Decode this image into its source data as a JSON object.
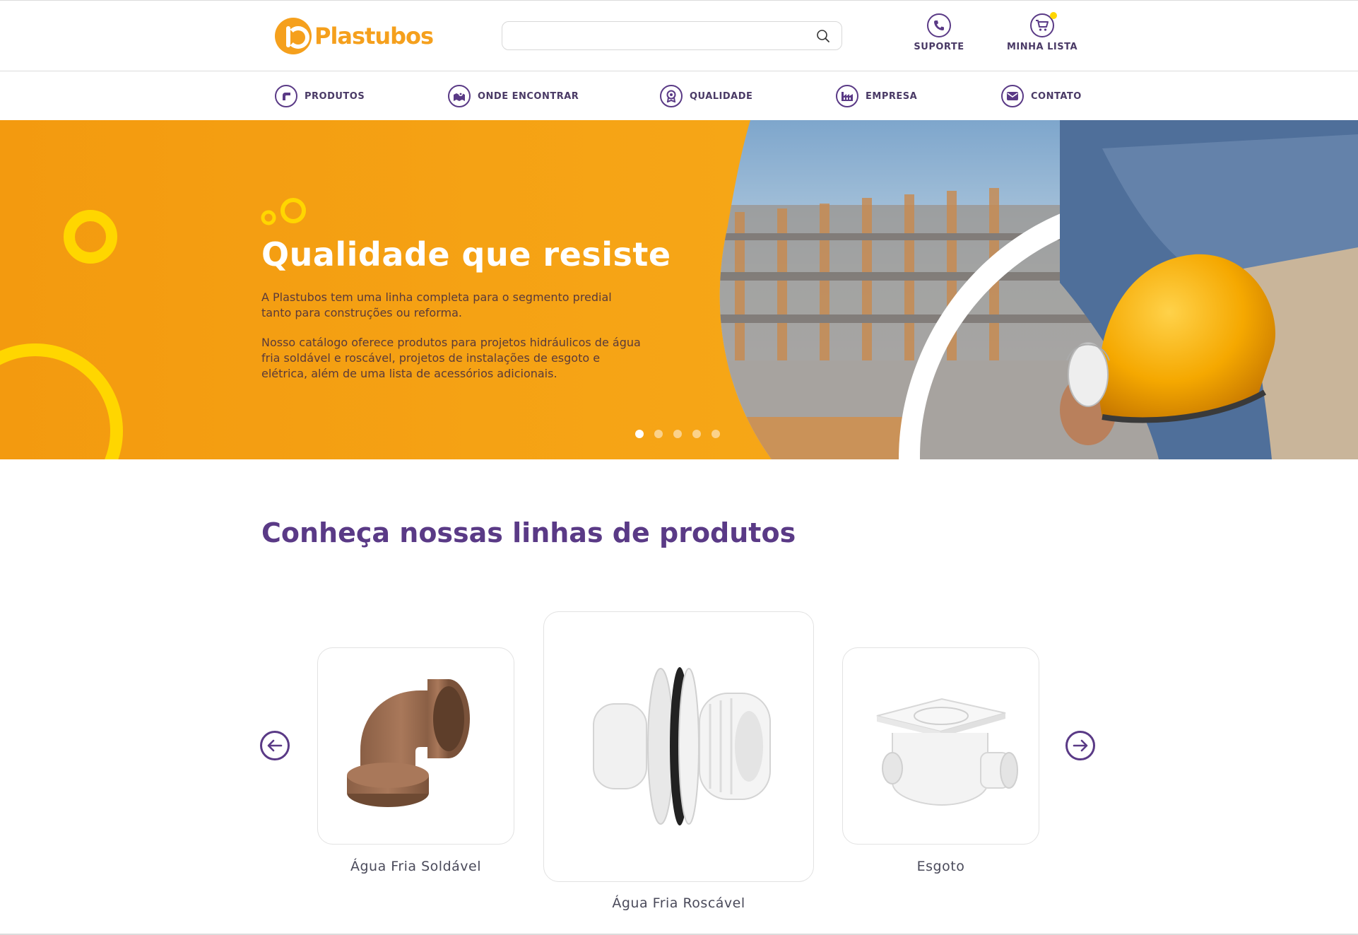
{
  "brand": {
    "name": "Plastubos",
    "orange": "#f5a01d",
    "purple": "#5a3a86",
    "yellow": "#ffd600"
  },
  "search": {
    "value": "",
    "placeholder": "",
    "icon": "search-icon"
  },
  "header_actions": [
    {
      "label": "SUPORTE",
      "icon": "phone-icon"
    },
    {
      "label": "MINHA LISTA",
      "icon": "cart-icon"
    }
  ],
  "nav": [
    {
      "label": "PRODUTOS",
      "icon": "pipe-icon"
    },
    {
      "label": "ONDE ENCONTRAR",
      "icon": "map-icon"
    },
    {
      "label": "QUALIDADE",
      "icon": "award-icon"
    },
    {
      "label": "EMPRESA",
      "icon": "factory-icon"
    },
    {
      "label": "CONTATO",
      "icon": "mail-icon"
    }
  ],
  "hero": {
    "title": "Qualidade que resiste",
    "paragraph_1": "A Plastubos tem uma linha completa para o segmento predial tanto para construções ou reforma.",
    "paragraph_2": "Nosso catálogo oferece produtos para projetos hidráulicos de água fria soldável e roscável, projetos de instalações de esgoto e elétrica, além de uma lista de acessórios adicionais.",
    "slides_count": 5,
    "active_slide": 1
  },
  "products": {
    "title": "Conheça nossas linhas de produtos",
    "prev_icon": "arrow-left-icon",
    "next_icon": "arrow-right-icon",
    "items": [
      {
        "label": "Água Fria Soldável",
        "image": "brown-elbow-fitting"
      },
      {
        "label": "Água Fria Roscável",
        "image": "white-threaded-adapter"
      },
      {
        "label": "Esgoto",
        "image": "white-floor-drain"
      }
    ]
  }
}
